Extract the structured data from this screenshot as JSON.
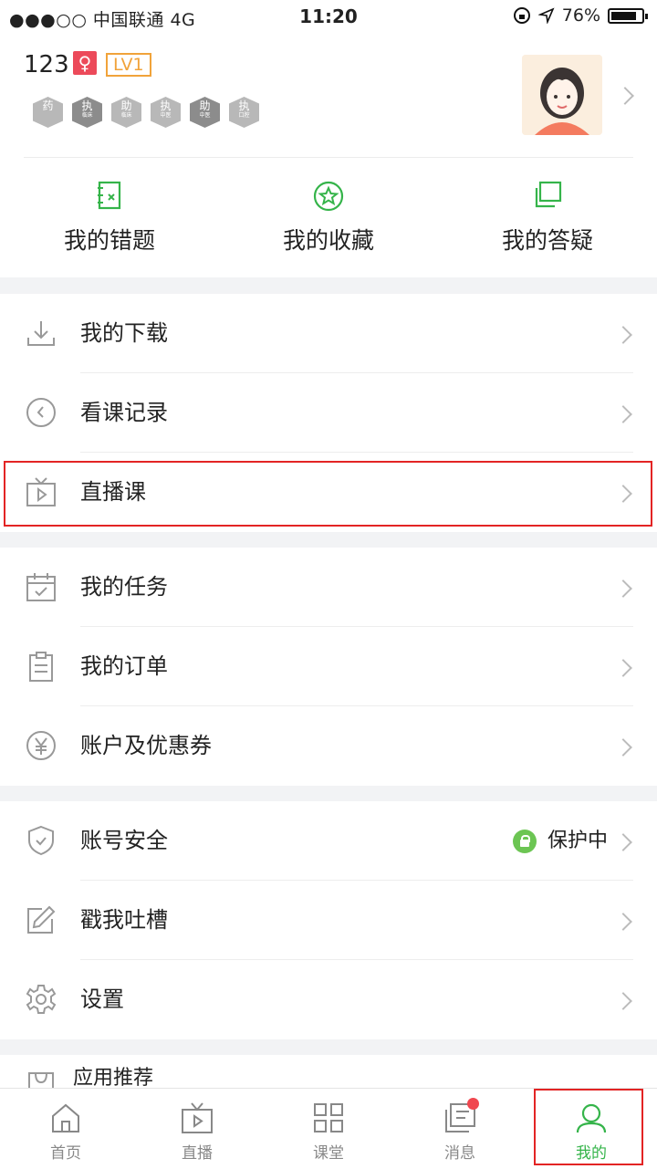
{
  "status_bar": {
    "carrier": "●●●○○ 中国联通 4G",
    "time": "11:20",
    "battery": "76%"
  },
  "profile": {
    "username": "123",
    "gender_symbol": "♀",
    "level": "LV1",
    "badges": [
      {
        "main": "药",
        "sub": ""
      },
      {
        "main": "执",
        "sub": "临床"
      },
      {
        "main": "助",
        "sub": "临床"
      },
      {
        "main": "执",
        "sub": "中医"
      },
      {
        "main": "助",
        "sub": "中医"
      },
      {
        "main": "执",
        "sub": "口腔"
      }
    ]
  },
  "quick_actions": [
    {
      "label": "我的错题",
      "icon": "wrong-notebook-icon"
    },
    {
      "label": "我的收藏",
      "icon": "star-icon"
    },
    {
      "label": "我的答疑",
      "icon": "qa-icon"
    }
  ],
  "menu": {
    "download": "我的下载",
    "history": "看课记录",
    "live": "直播课",
    "tasks": "我的任务",
    "orders": "我的订单",
    "account_coupons": "账户及优惠券",
    "security": "账号安全",
    "security_status": "保护中",
    "feedback": "戳我吐槽",
    "settings": "设置",
    "recommend": "应用推荐"
  },
  "tabbar": [
    {
      "label": "首页",
      "icon": "home-icon"
    },
    {
      "label": "直播",
      "icon": "tv-icon"
    },
    {
      "label": "课堂",
      "icon": "grid-icon"
    },
    {
      "label": "消息",
      "icon": "message-icon"
    },
    {
      "label": "我的",
      "icon": "person-icon"
    }
  ],
  "colors": {
    "accent": "#35b44a",
    "badge_red": "#f0474f",
    "highlight": "#e32424"
  }
}
